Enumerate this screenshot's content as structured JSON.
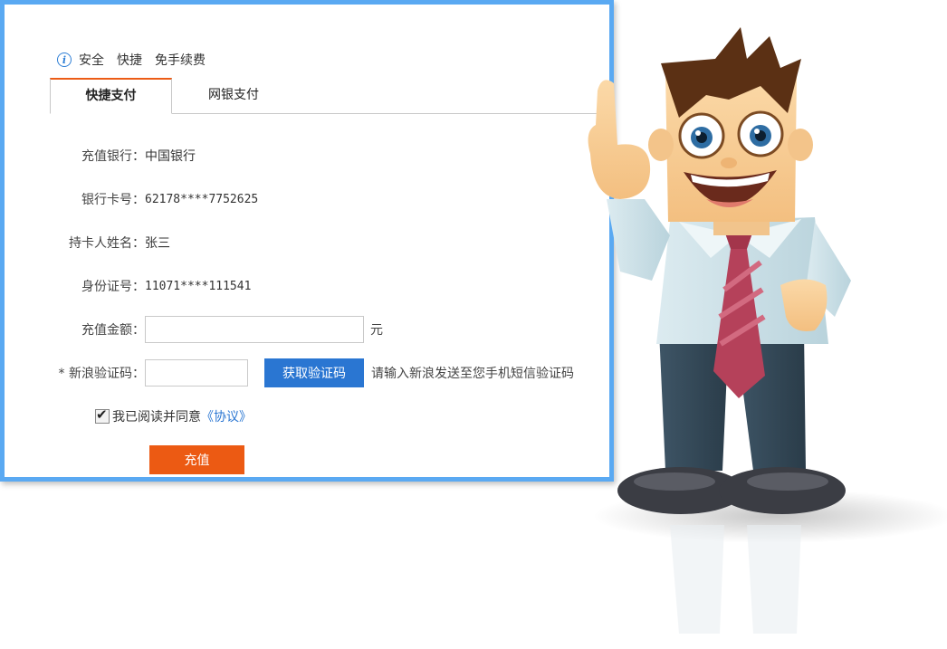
{
  "features": [
    "安全",
    "快捷",
    "免手续费"
  ],
  "tabs": [
    {
      "label": "快捷支付",
      "active": true
    },
    {
      "label": "网银支付",
      "active": false
    }
  ],
  "form": {
    "bank_label": "充值银行：",
    "bank_value": "中国银行",
    "card_label": "银行卡号：",
    "card_value": "62178****7752625",
    "name_label": "持卡人姓名：",
    "name_value": "张三",
    "id_label": "身份证号：",
    "id_value": "11071****111541",
    "amount_label": "充值金额：",
    "amount_value": "",
    "amount_unit": "元",
    "code_label": "* 新浪验证码：",
    "code_value": "",
    "get_code_button": "获取验证码",
    "code_hint": "请输入新浪发送至您手机短信验证码",
    "agree_checked": true,
    "agree_text": "我已阅读并同意",
    "agree_link": "《协议》",
    "submit_button": "充值"
  },
  "colors": {
    "frame": "#5aa9f2",
    "accent_orange": "#ec5a13",
    "primary_blue": "#2a76d2"
  }
}
